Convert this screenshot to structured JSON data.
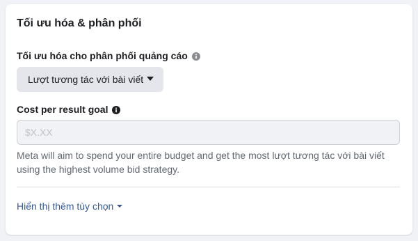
{
  "section": {
    "title": "Tối ưu hóa & phân phối"
  },
  "optimization": {
    "label": "Tối ưu hóa cho phân phối quảng cáo",
    "selected": "Lượt tương tác với bài viết"
  },
  "cost_goal": {
    "label": "Cost per result goal",
    "placeholder": "$X.XX",
    "value": "",
    "help": "Meta will aim to spend your entire budget and get the most lượt tương tác với bài viết using the highest volume bid strategy."
  },
  "more_options": {
    "label": "Hiển thị thêm tùy chọn"
  },
  "colors": {
    "link": "#385898",
    "card_bg": "#ffffff",
    "page_bg": "#f0f2f5"
  },
  "icons": {
    "info_light": "info-icon",
    "info_dark": "info-icon",
    "dropdown": "caret-down-icon"
  }
}
